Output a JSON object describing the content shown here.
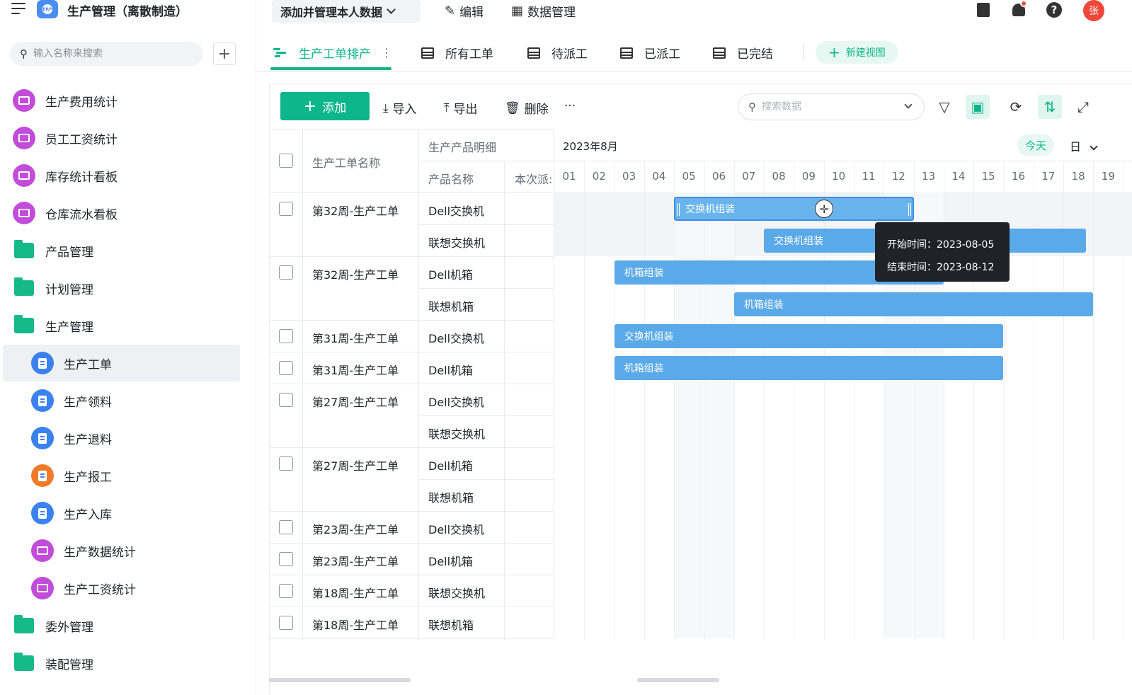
{
  "app": {
    "title": "生产管理（离散制造）",
    "logo_text": "ERP"
  },
  "sidebar": {
    "search_placeholder": "输入名称来搜索",
    "add_label": "+",
    "items": [
      {
        "label": "生产费用统计",
        "icon": "dashboard-icon",
        "level": 1,
        "color": "#c24dd8"
      },
      {
        "label": "员工工资统计",
        "icon": "dashboard-icon",
        "level": 1,
        "color": "#c24dd8"
      },
      {
        "label": "库存统计看板",
        "icon": "dashboard-icon",
        "level": 1,
        "color": "#c24dd8"
      },
      {
        "label": "仓库流水看板",
        "icon": "dashboard-icon",
        "level": 1,
        "color": "#c24dd8"
      },
      {
        "label": "产品管理",
        "icon": "folder-icon",
        "level": 1,
        "color": "#16b98a"
      },
      {
        "label": "计划管理",
        "icon": "folder-icon",
        "level": 1,
        "color": "#16b98a"
      },
      {
        "label": "生产管理",
        "icon": "folder-open-icon",
        "level": 1,
        "color": "#16b98a"
      },
      {
        "label": "生产工单",
        "icon": "form-icon",
        "level": 2,
        "color": "#3b82f0",
        "active": true
      },
      {
        "label": "生产领料",
        "icon": "form-icon",
        "level": 2,
        "color": "#3b82f0"
      },
      {
        "label": "生产退料",
        "icon": "form-icon",
        "level": 2,
        "color": "#3b82f0"
      },
      {
        "label": "生产报工",
        "icon": "form-icon",
        "level": 2,
        "color": "#f07a2a"
      },
      {
        "label": "生产入库",
        "icon": "form-icon",
        "level": 2,
        "color": "#3b82f0"
      },
      {
        "label": "生产数据统计",
        "icon": "dashboard-icon",
        "level": 2,
        "color": "#c24dd8"
      },
      {
        "label": "生产工资统计",
        "icon": "dashboard-icon",
        "level": 2,
        "color": "#c24dd8"
      },
      {
        "label": "委外管理",
        "icon": "folder-icon",
        "level": 1,
        "color": "#16b98a"
      },
      {
        "label": "装配管理",
        "icon": "folder-icon",
        "level": 1,
        "color": "#16b98a"
      }
    ]
  },
  "topbar": {
    "view_select": "添加并管理本人数据",
    "edit_label": "编辑",
    "data_manage_label": "数据管理",
    "avatar_text": "张"
  },
  "tabs": {
    "items": [
      "生产工单排产",
      "所有工单",
      "待派工",
      "已派工",
      "已完结"
    ],
    "active": "生产工单排产",
    "new_view_label": "新建视图"
  },
  "toolbar": {
    "add_label": "添加",
    "import_label": "导入",
    "export_label": "导出",
    "delete_label": "删除",
    "more_label": "···",
    "search_placeholder": "搜索数据"
  },
  "table": {
    "col_name": "生产工单名称",
    "group_detail": "生产产品明细",
    "col_product": "产品名称",
    "col_dispatch": "本次派:",
    "rows": [
      {
        "order": "第32周-生产工单",
        "products": [
          "Dell交换机",
          "联想交换机"
        ]
      },
      {
        "order": "第32周-生产工单",
        "products": [
          "Dell机箱",
          "联想机箱"
        ]
      },
      {
        "order": "第31周-生产工单",
        "products": [
          "Dell交换机"
        ]
      },
      {
        "order": "第31周-生产工单",
        "products": [
          "Dell机箱"
        ]
      },
      {
        "order": "第27周-生产工单",
        "products": [
          "Dell交换机",
          "联想交换机"
        ]
      },
      {
        "order": "第27周-生产工单",
        "products": [
          "Dell机箱",
          "联想机箱"
        ]
      },
      {
        "order": "第23周-生产工单",
        "products": [
          "Dell交换机"
        ]
      },
      {
        "order": "第23周-生产工单",
        "products": [
          "Dell机箱"
        ]
      },
      {
        "order": "第18周-生产工单",
        "products": [
          "联想交换机"
        ]
      },
      {
        "order": "第18周-生产工单",
        "products": [
          "联想机箱"
        ]
      }
    ]
  },
  "gantt": {
    "month": "2023年8月",
    "today_label": "今天",
    "scale_label": "日",
    "days": [
      "01",
      "02",
      "03",
      "04",
      "05",
      "06",
      "07",
      "08",
      "09",
      "10",
      "11",
      "12",
      "13",
      "14",
      "15",
      "16",
      "17",
      "18",
      "19"
    ],
    "bars": [
      {
        "label": "交换机组装",
        "start": 5,
        "end": 12,
        "row": 0,
        "selected": true
      },
      {
        "label": "交换机组装",
        "start": 8,
        "end": 19,
        "row": 1
      },
      {
        "label": "机箱组装",
        "start": 3,
        "end": 13,
        "row": 2
      },
      {
        "label": "机箱组装",
        "start": 7,
        "end": 18,
        "row": 3
      },
      {
        "label": "交换机组装",
        "start": 3,
        "end": 15,
        "row": 4
      },
      {
        "label": "机箱组装",
        "start": 3,
        "end": 15,
        "row": 5
      }
    ],
    "tooltip": {
      "start": "开始时间：2023-08-05",
      "end": "结束时间：2023-08-12"
    }
  }
}
